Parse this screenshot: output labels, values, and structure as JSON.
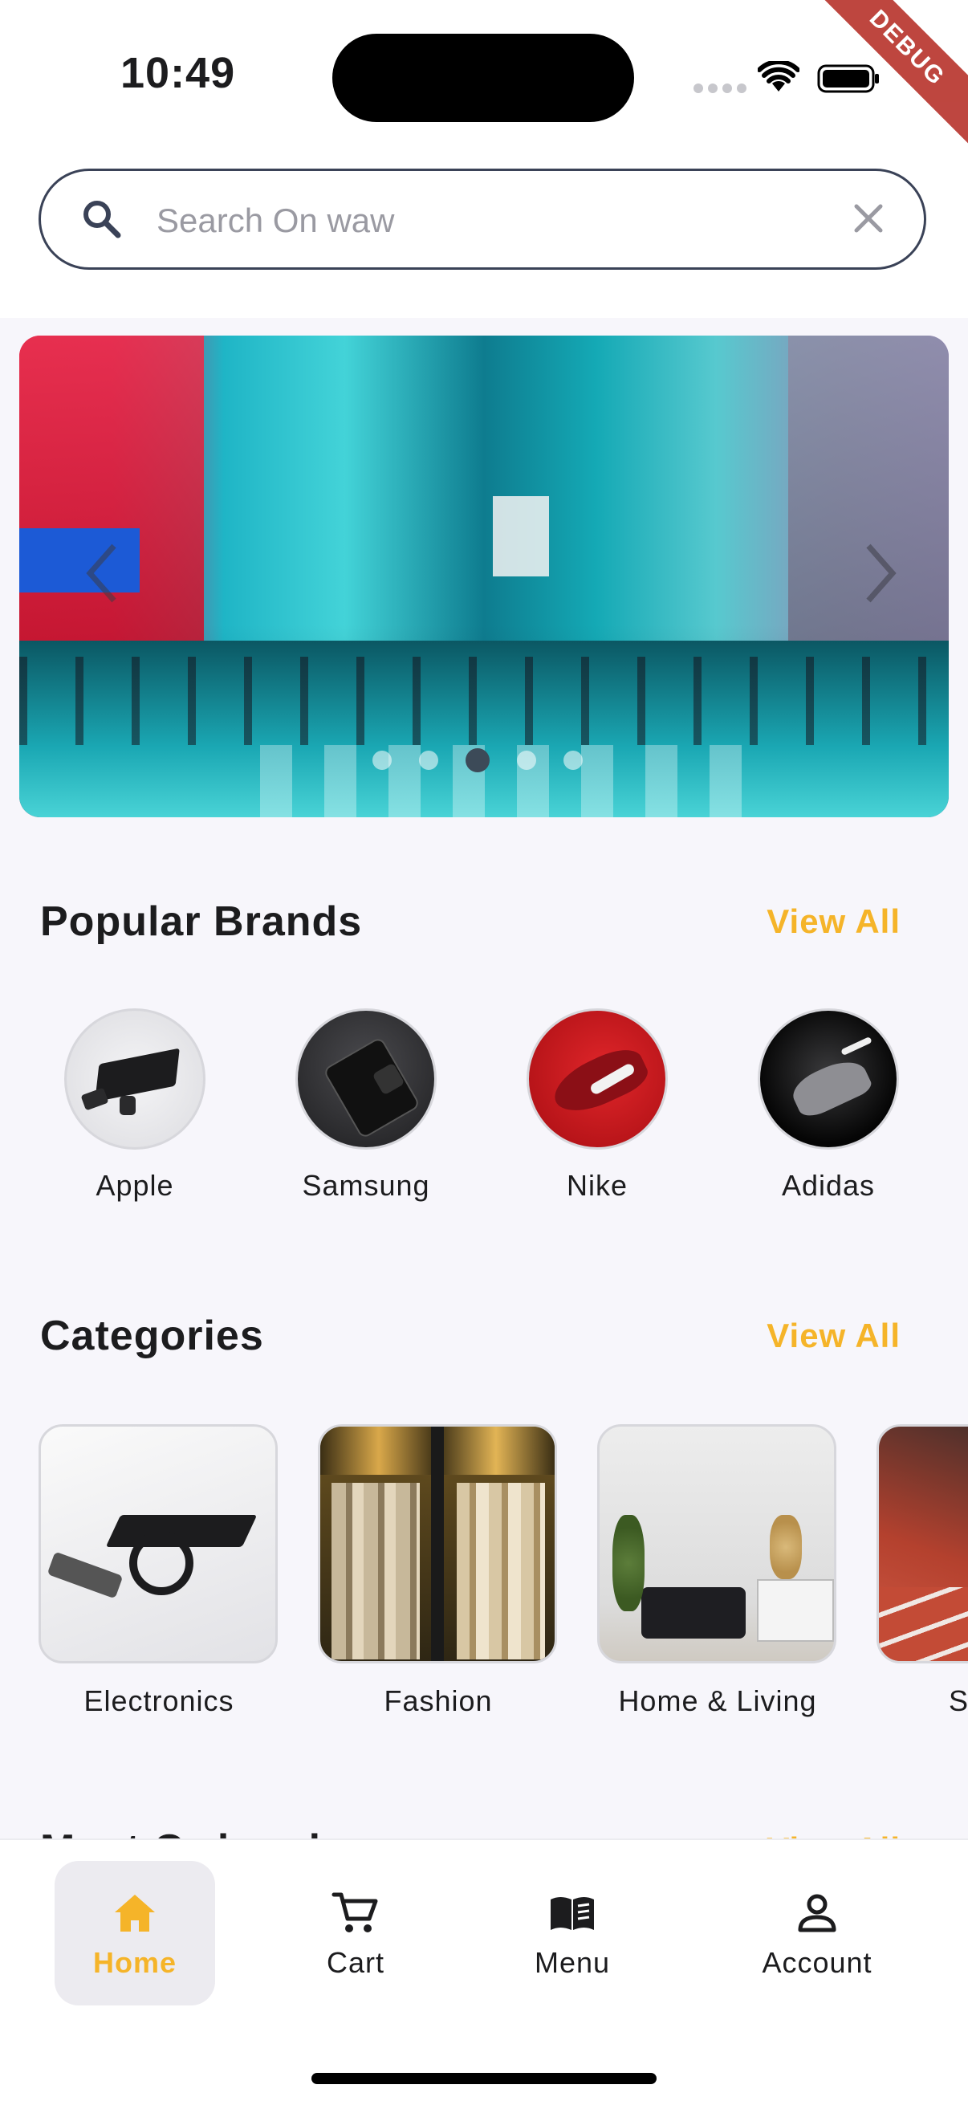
{
  "status_bar": {
    "time": "10:49",
    "debug_label": "DEBUG"
  },
  "search": {
    "placeholder": "Search On waw",
    "icon": "search-icon",
    "clear_icon": "close-icon"
  },
  "banner": {
    "slides_count": 5,
    "active_slide": 3,
    "prev_icon": "chevron-left-icon",
    "next_icon": "chevron-right-icon"
  },
  "popular_brands": {
    "title": "Popular Brands",
    "view_all": "View All",
    "items": [
      {
        "name": "Apple"
      },
      {
        "name": "Samsung"
      },
      {
        "name": "Nike"
      },
      {
        "name": "Adidas"
      }
    ]
  },
  "categories": {
    "title": "Categories",
    "view_all": "View All",
    "items": [
      {
        "name": "Electronics"
      },
      {
        "name": "Fashion"
      },
      {
        "name": "Home & Living"
      },
      {
        "name": "S"
      }
    ]
  },
  "most_ordered": {
    "title": "Most Ordered",
    "view_all": "View All"
  },
  "bottom_nav": {
    "items": [
      {
        "label": "Home",
        "icon": "home-icon",
        "active": true
      },
      {
        "label": "Cart",
        "icon": "cart-icon",
        "active": false
      },
      {
        "label": "Menu",
        "icon": "menu-book-icon",
        "active": false
      },
      {
        "label": "Account",
        "icon": "account-icon",
        "active": false
      }
    ]
  },
  "colors": {
    "accent": "#f5b429",
    "search_border": "#3a4257",
    "background": "#f7f6fb"
  }
}
